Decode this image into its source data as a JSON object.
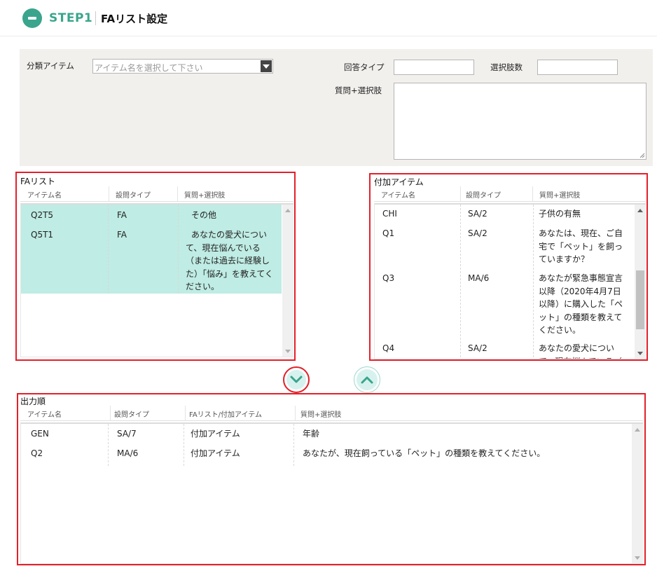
{
  "header": {
    "step": "STEP1",
    "title": "FAリスト設定",
    "collapse_icon": "minus-circle-icon"
  },
  "classify": {
    "item_label": "分類アイテム",
    "item_placeholder": "アイテム名を選択して下さい",
    "answer_type_label": "回答タイプ",
    "answer_type_value": "",
    "choice_count_label": "選択肢数",
    "choice_count_value": "",
    "question_label": "質問+選択肢",
    "question_value": ""
  },
  "fa_list": {
    "title": "FAリスト",
    "columns": [
      "アイテム名",
      "設問タイプ",
      "質問+選択肢"
    ],
    "rows": [
      {
        "name": "Q2T5",
        "type": "FA",
        "question": "その他"
      },
      {
        "name": "Q5T1",
        "type": "FA",
        "question": "あなたの愛犬について、現在悩んでいる（または過去に経験した）「悩み」を教えてください。"
      }
    ],
    "highlight_color": "#bfece4"
  },
  "extra_items": {
    "title": "付加アイテム",
    "columns": [
      "アイテム名",
      "設問タイプ",
      "質問+選択肢"
    ],
    "rows": [
      {
        "name": "CHI",
        "type": "SA/2",
        "question": "子供の有無"
      },
      {
        "name": "Q1",
        "type": "SA/2",
        "question": "あなたは、現在、ご自宅で「ペット」を飼っていますか？"
      },
      {
        "name": "Q3",
        "type": "MA/6",
        "question": "あなたが緊急事態宣言以降（2020年4月7日以降）に購入した「ペット」の種類を教えてください。"
      },
      {
        "name": "Q4",
        "type": "SA/2",
        "question": "あなたの愛犬について、現在悩んでいる（"
      }
    ]
  },
  "output_order": {
    "title": "出力順",
    "columns": [
      "アイテム名",
      "設問タイプ",
      "FAリスト/付加アイテム",
      "質問+選択肢"
    ],
    "rows": [
      {
        "name": "GEN",
        "type": "SA/7",
        "source": "付加アイテム",
        "question": "年齢"
      },
      {
        "name": "Q2",
        "type": "MA/6",
        "source": "付加アイテム",
        "question": "あなたが、現在飼っている「ペット」の種類を教えてください。"
      }
    ]
  },
  "controls": {
    "move_down_icon": "chevron-down-icon",
    "move_up_icon": "chevron-up-icon"
  },
  "colors": {
    "accent": "#3aa58c",
    "highlight_border": "#e3202a",
    "panel_bg": "#f2f0ed"
  }
}
